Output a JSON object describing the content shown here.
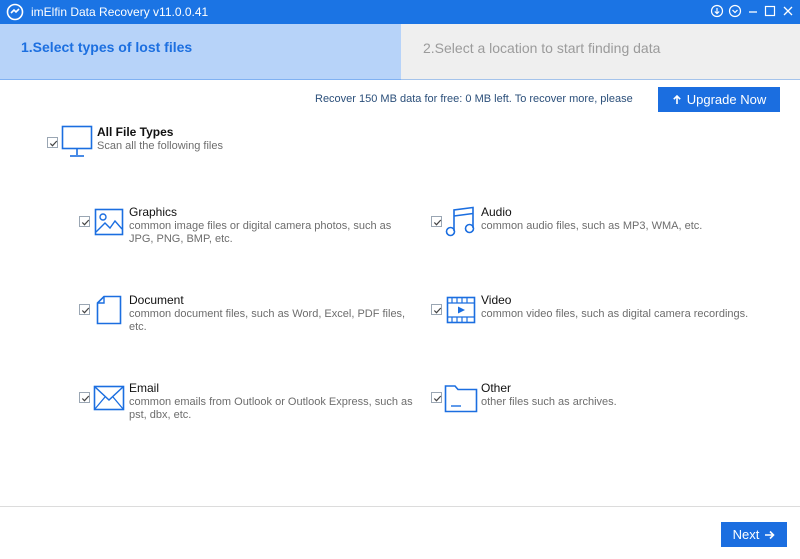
{
  "window": {
    "title": "imElfin Data Recovery v11.0.0.41",
    "controls": [
      "download-icon",
      "chevron-down-icon",
      "minimize-icon",
      "maximize-icon",
      "close-icon"
    ]
  },
  "steps": [
    {
      "label": "1.Select types of lost files",
      "active": true
    },
    {
      "label": "2.Select a location to start finding data",
      "active": false
    }
  ],
  "promo": {
    "text": "Recover 150 MB data for free: 0 MB left. To recover more, please",
    "upgrade_label": "Upgrade Now"
  },
  "all_types": {
    "title": "All File Types",
    "desc": "Scan all the following files",
    "checked": true
  },
  "file_types": {
    "graphics": {
      "title": "Graphics",
      "line1": "common image files or digital camera photos, such as",
      "line2": "JPG, PNG, BMP, etc.",
      "checked": true
    },
    "audio": {
      "title": "Audio",
      "line1": "common audio files, such as MP3, WMA, etc.",
      "checked": true
    },
    "document": {
      "title": "Document",
      "line1": "common document files, such as Word, Excel, PDF files,",
      "line2": "etc.",
      "checked": true
    },
    "video": {
      "title": "Video",
      "line1": "common video files, such as digital camera recordings.",
      "checked": true
    },
    "email": {
      "title": "Email",
      "line1": "common emails from Outlook or Outlook Express, such as",
      "line2": "pst, dbx, etc.",
      "checked": true
    },
    "other": {
      "title": "Other",
      "line1": "other files such as archives.",
      "checked": true
    }
  },
  "footer": {
    "next_label": "Next"
  },
  "colors": {
    "accent": "#1b74e4",
    "active_tab": "#b7d3f9",
    "button": "#1b6ee0"
  }
}
